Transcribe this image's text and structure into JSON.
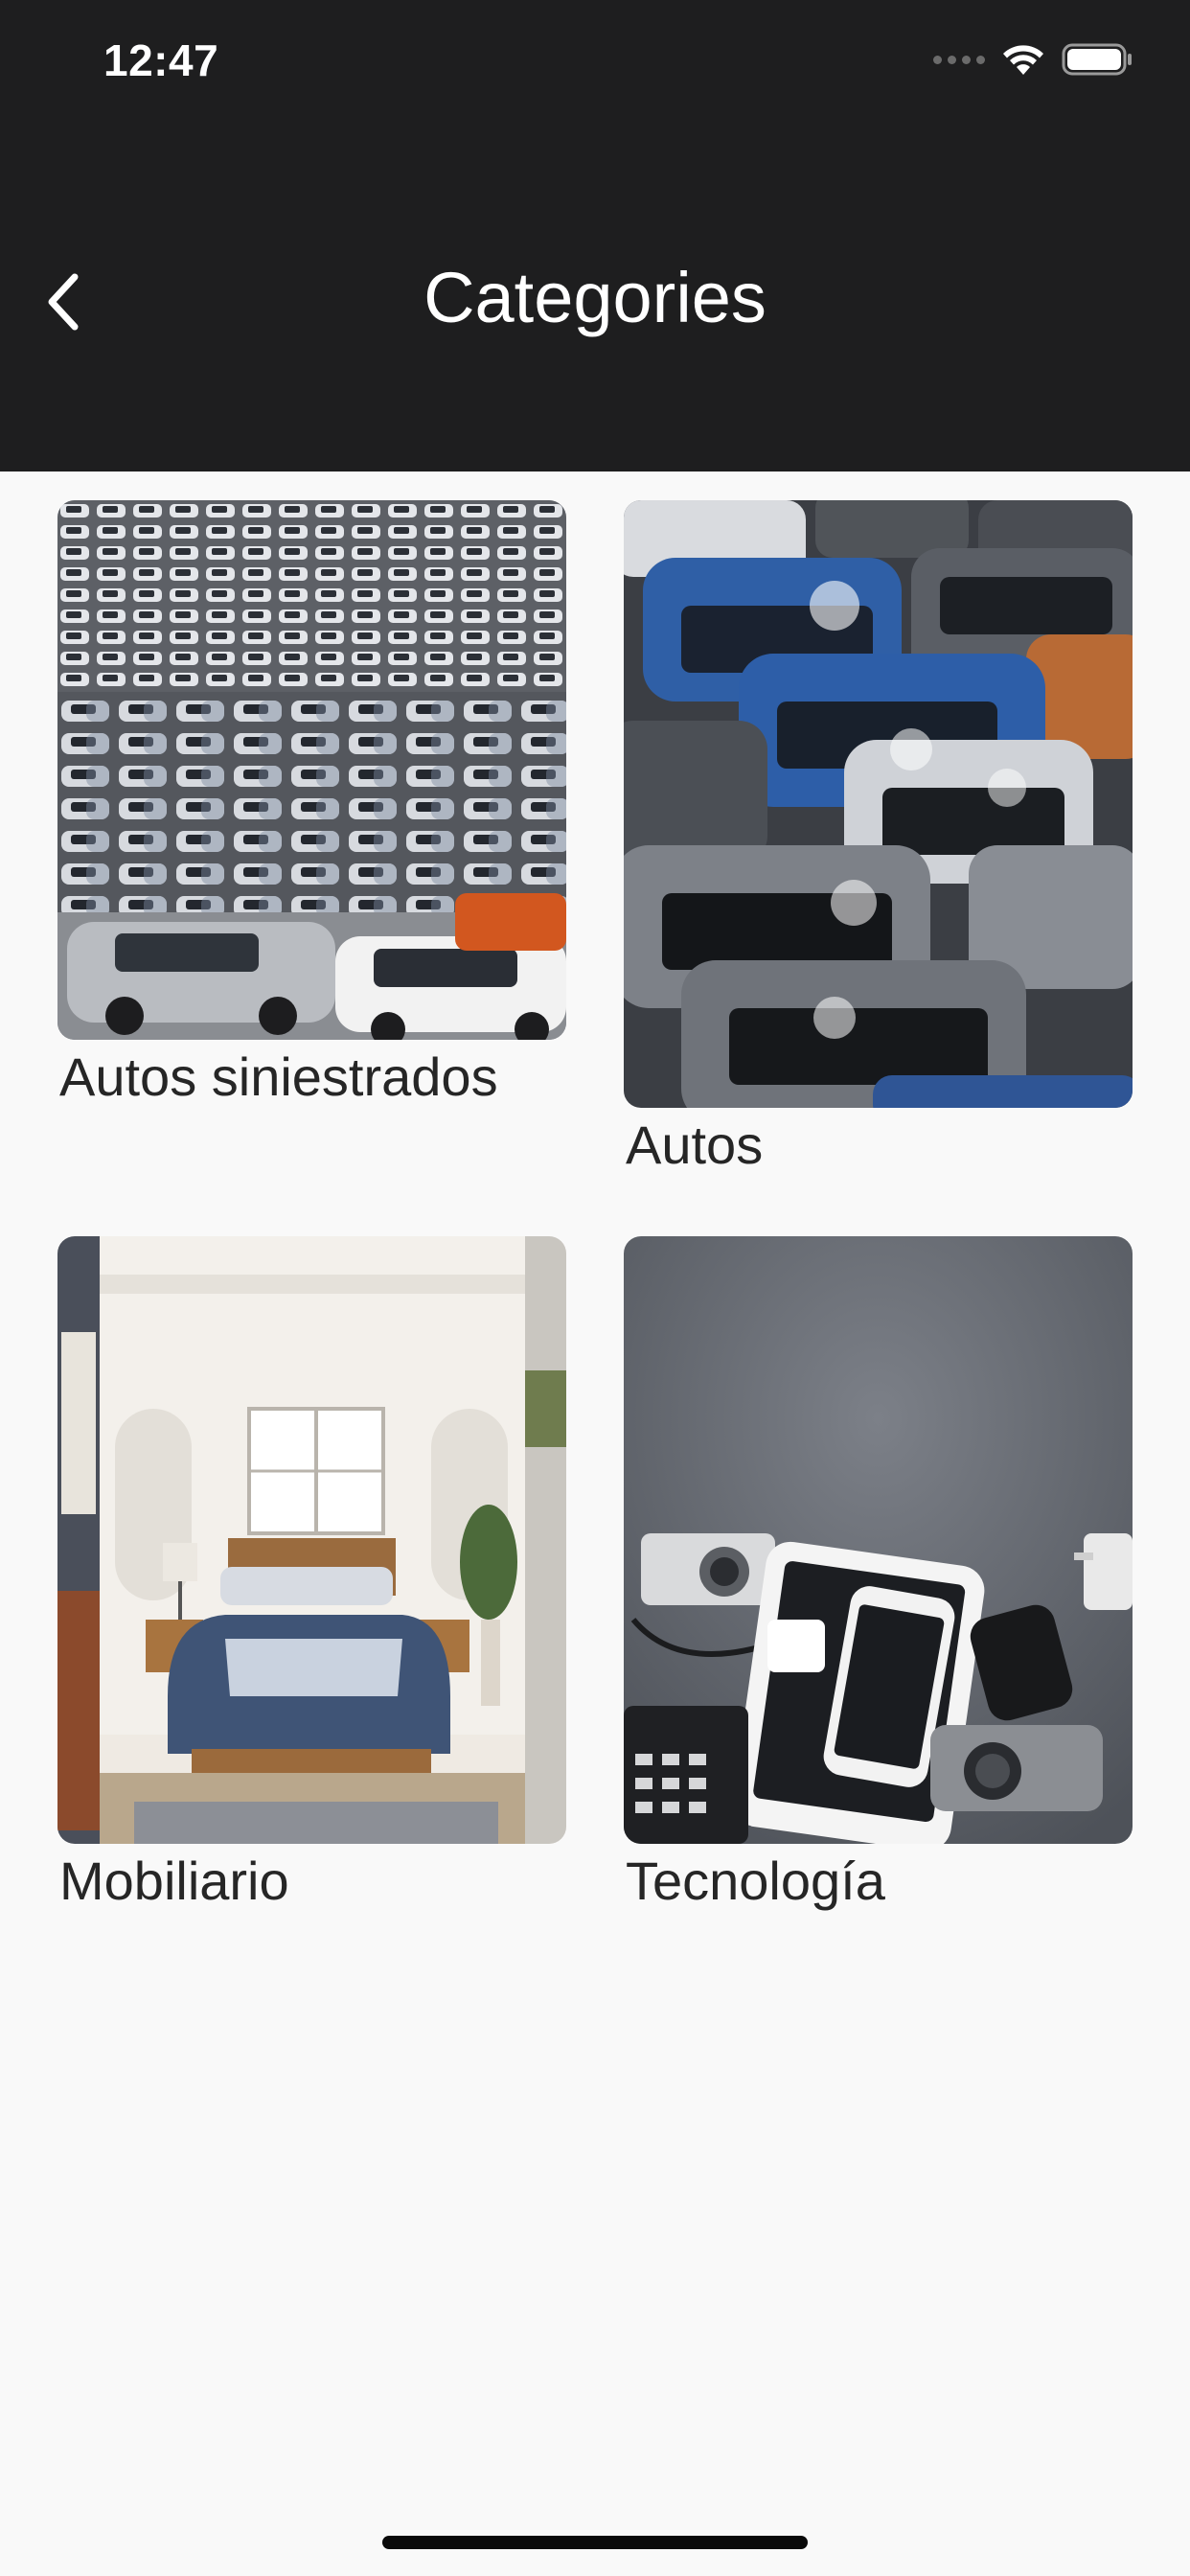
{
  "status_bar": {
    "time": "12:47"
  },
  "nav": {
    "title": "Categories",
    "back_icon": "chevron-left-icon"
  },
  "categories": [
    {
      "label": "Autos siniestrados",
      "image": "parking-lot-photo"
    },
    {
      "label": "Autos",
      "image": "parked-cars-photo"
    },
    {
      "label": "Mobiliario",
      "image": "bedroom-photo"
    },
    {
      "label": "Tecnología",
      "image": "electronics-photo"
    }
  ],
  "colors": {
    "header_bg": "#1e1e1f",
    "page_bg": "#f9f9f9",
    "label_text": "#262626"
  }
}
